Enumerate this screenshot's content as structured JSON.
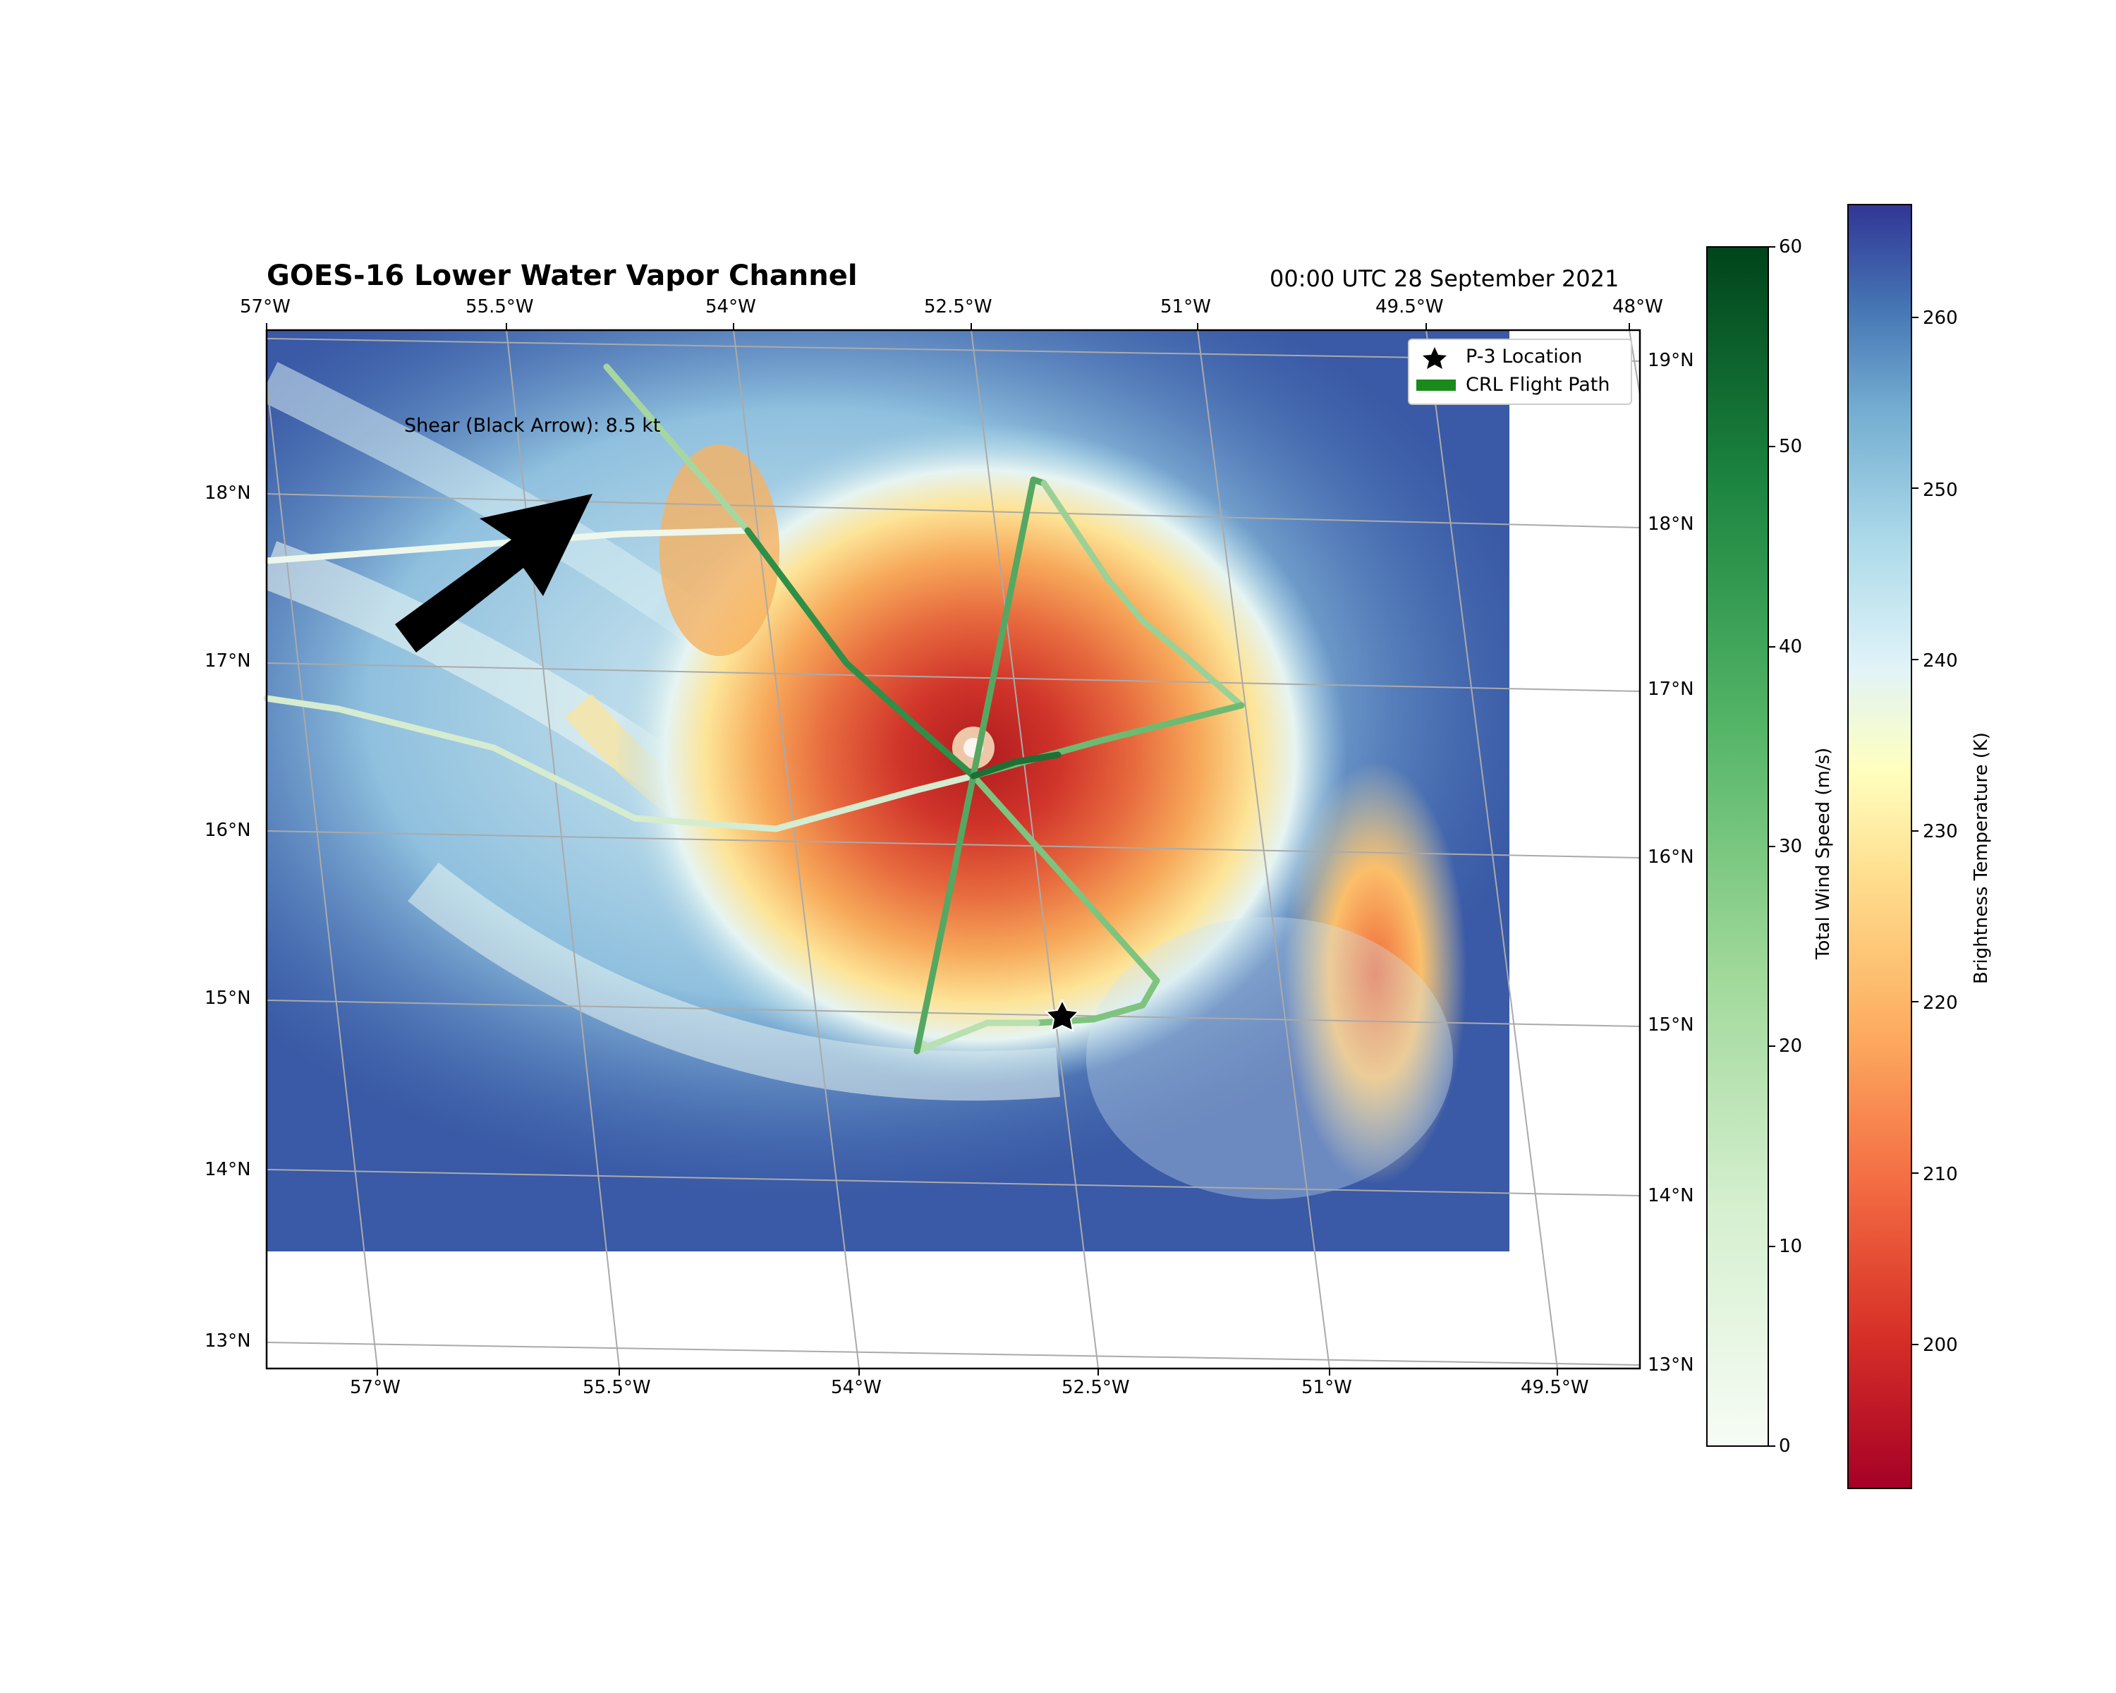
{
  "title": "GOES-16 Lower Water Vapor Channel",
  "datetime": "00:00 UTC 28 September 2021",
  "annotation": "Shear (Black Arrow): 8.5 kt",
  "legend": {
    "p3_label": "P-3 Location",
    "flight_label": "CRL Flight Path"
  },
  "top_lon_ticks": [
    "57°W",
    "55.5°W",
    "54°W",
    "52.5°W",
    "51°W",
    "49.5°W",
    "48°W"
  ],
  "bottom_lon_ticks": [
    "57°W",
    "55.5°W",
    "54°W",
    "52.5°W",
    "51°W",
    "49.5°W"
  ],
  "left_lat_ticks": [
    "18°N",
    "17°N",
    "16°N",
    "15°N",
    "14°N",
    "13°N"
  ],
  "right_lat_ticks": [
    "19°N",
    "18°N",
    "17°N",
    "16°N",
    "15°N",
    "14°N",
    "13°N"
  ],
  "wind_colorbar": {
    "label": "Total Wind Speed (m/s)",
    "ticks": [
      "0",
      "10",
      "20",
      "30",
      "40",
      "50",
      "60"
    ],
    "min": 0,
    "max": 60,
    "colormap": "Greens"
  },
  "temp_colorbar": {
    "label": "Brightness Temperature (K)",
    "ticks": [
      "200",
      "210",
      "220",
      "230",
      "240",
      "250",
      "260"
    ],
    "min": 192,
    "max": 267,
    "colormap": "RdYlBu"
  },
  "shear": {
    "speed_kt": 8.5,
    "direction": "toward northeast"
  },
  "p3_location": {
    "lat": 14.9,
    "lon": -52.4
  },
  "colors": {
    "arrow": "#000000",
    "legend_flight": "#1a8a1a",
    "grid": "#aaaaaa"
  }
}
